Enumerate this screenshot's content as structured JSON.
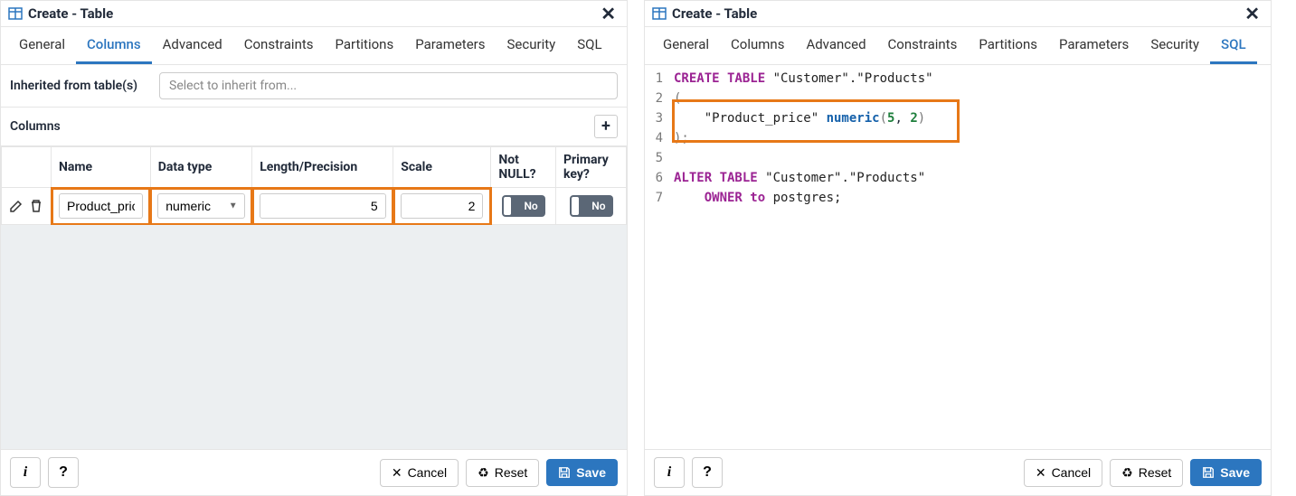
{
  "dialog_title": "Create - Table",
  "tabs": {
    "general": "General",
    "columns": "Columns",
    "advanced": "Advanced",
    "constraints": "Constraints",
    "partitions": "Partitions",
    "parameters": "Parameters",
    "security": "Security",
    "sql": "SQL"
  },
  "left": {
    "active_tab": "Columns",
    "inherit_label": "Inherited from table(s)",
    "inherit_placeholder": "Select to inherit from...",
    "columns_heading": "Columns",
    "table_headers": {
      "name": "Name",
      "data_type": "Data type",
      "length": "Length/Precision",
      "scale": "Scale",
      "not_null": "Not NULL?",
      "primary_key": "Primary key?"
    },
    "row": {
      "name": "Product_price",
      "data_type": "numeric",
      "length": "5",
      "scale": "2",
      "not_null_label": "No",
      "primary_key_label": "No"
    }
  },
  "right": {
    "active_tab": "SQL",
    "sql_lines": {
      "l1": {
        "kw": "CREATE TABLE ",
        "str": "\"Customer\".\"Products\""
      },
      "l2": "(",
      "l3": {
        "indent": "    ",
        "str": "\"Product_price\" ",
        "kw": "numeric",
        "open": "(",
        "a": "5",
        "comma": ", ",
        "b": "2",
        "close": ")"
      },
      "l4": ");",
      "l5": "",
      "l6": {
        "kw": "ALTER TABLE ",
        "str": "\"Customer\".\"Products\""
      },
      "l7": {
        "indent": "    ",
        "kw": "OWNER to ",
        "ident": "postgres;"
      }
    }
  },
  "footer": {
    "info": "i",
    "help": "?",
    "cancel": "Cancel",
    "reset": "Reset",
    "save": "Save"
  }
}
